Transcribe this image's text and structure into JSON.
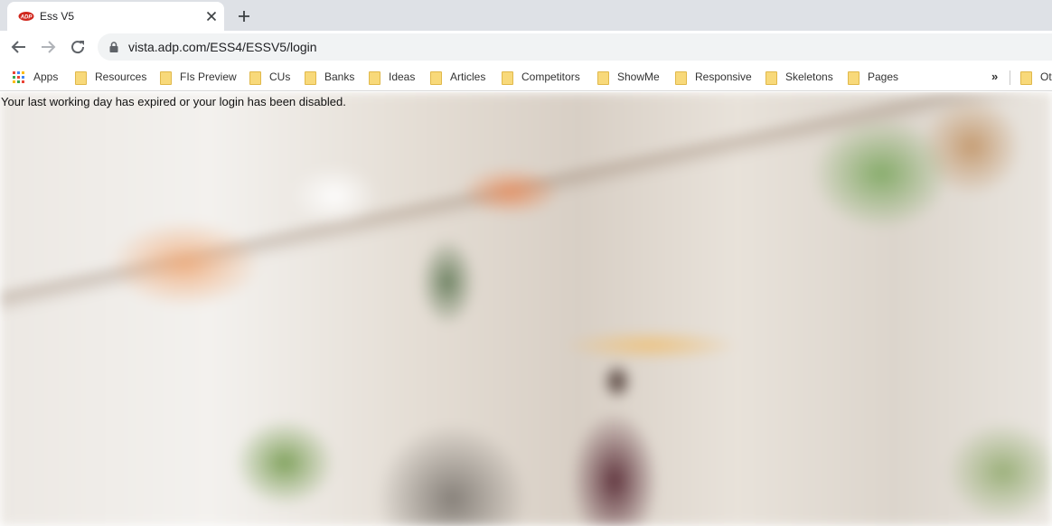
{
  "browser": {
    "tab": {
      "title": "Ess V5",
      "favicon": "adp-logo-icon",
      "close_icon": "close-icon"
    },
    "new_tab_icon": "plus-icon",
    "nav": {
      "back": "arrow-left-icon",
      "forward": "arrow-right-icon",
      "reload": "reload-icon"
    },
    "address_bar": {
      "lock_icon": "lock-icon",
      "url": "vista.adp.com/ESS4/ESSV5/login"
    },
    "bookmarks": {
      "apps_label": "Apps",
      "items": [
        {
          "label": "Resources"
        },
        {
          "label": "FIs Preview"
        },
        {
          "label": "CUs"
        },
        {
          "label": "Banks"
        },
        {
          "label": "Ideas"
        },
        {
          "label": "Articles"
        },
        {
          "label": "Competitors"
        },
        {
          "label": "ShowMe"
        },
        {
          "label": "Responsive"
        },
        {
          "label": "Skeletons"
        },
        {
          "label": "Pages"
        }
      ],
      "overflow_label": "»",
      "other_label": "Ot"
    }
  },
  "page": {
    "message": "Your last working day has expired or your login has been disabled."
  }
}
